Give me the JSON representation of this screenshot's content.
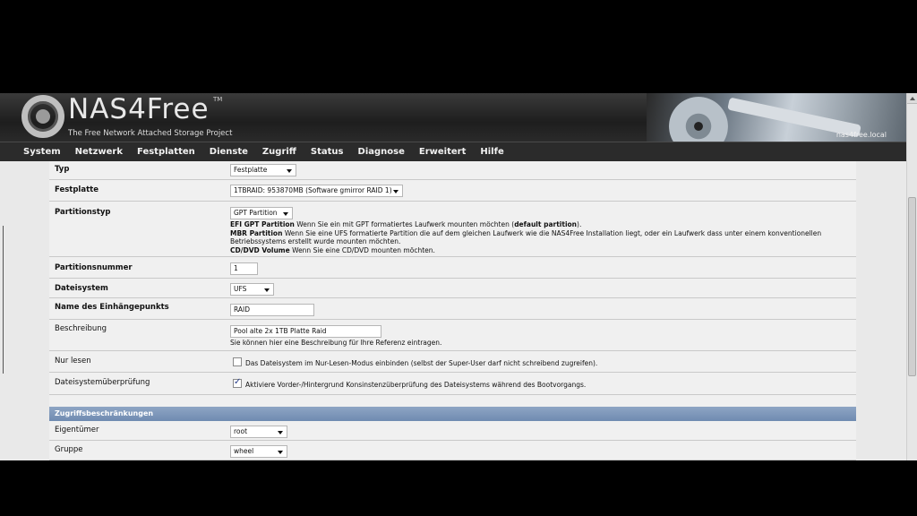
{
  "header": {
    "logo_text": "NAS4Free",
    "logo_tm": "TM",
    "logo_subtitle": "The Free Network Attached Storage Project",
    "hostname": "nas4free.local"
  },
  "nav": [
    "System",
    "Netzwerk",
    "Festplatten",
    "Dienste",
    "Zugriff",
    "Status",
    "Diagnose",
    "Erweitert",
    "Hilfe"
  ],
  "form": {
    "typ": {
      "label": "Typ",
      "value": "Festplatte"
    },
    "festplatte": {
      "label": "Festplatte",
      "value": "1TBRAID: 953870MB (Software gmirror RAID 1)"
    },
    "partitionstyp": {
      "label": "Partitionstyp",
      "value": "GPT Partition",
      "desc": [
        {
          "b": "EFI GPT Partition",
          "t": " Wenn Sie ein mit GPT formatiertes Laufwerk mounten möchten (",
          "b2": "default partition",
          "t2": ")."
        },
        {
          "b": "MBR Partition",
          "t": " Wenn Sie eine UFS formatierte Partition die auf dem gleichen Laufwerk wie die NAS4Free Installation liegt, oder ein Laufwerk dass unter einem konventionellen Betriebssystems erstellt wurde mounten möchten."
        },
        {
          "b": "CD/DVD Volume",
          "t": " Wenn Sie eine CD/DVD mounten möchten."
        }
      ]
    },
    "partitionsnummer": {
      "label": "Partitionsnummer",
      "value": "1"
    },
    "dateisystem": {
      "label": "Dateisystem",
      "value": "UFS"
    },
    "mountname": {
      "label": "Name des Einhängepunkts",
      "value": "RAID"
    },
    "beschreibung": {
      "label": "Beschreibung",
      "value": "Pool alte 2x 1TB  Platte Raid",
      "hint": "Sie können hier eine Beschreibung für Ihre Referenz eintragen."
    },
    "nurlesen": {
      "label": "Nur lesen",
      "checked": false,
      "text": "Das Dateisystem im Nur-Lesen-Modus einbinden (selbst der Super-User darf nicht schreibend zugreifen)."
    },
    "fsck": {
      "label": "Dateisystemüberprüfung",
      "checked": true,
      "text": "Aktiviere Vorder-/Hintergrund Konsinstenzüberprüfung des Dateisystems während des Bootvorgangs."
    }
  },
  "access": {
    "title": "Zugriffsbeschränkungen",
    "owner": {
      "label": "Eigentümer",
      "value": "root"
    },
    "group": {
      "label": "Gruppe",
      "value": "wheel"
    }
  }
}
